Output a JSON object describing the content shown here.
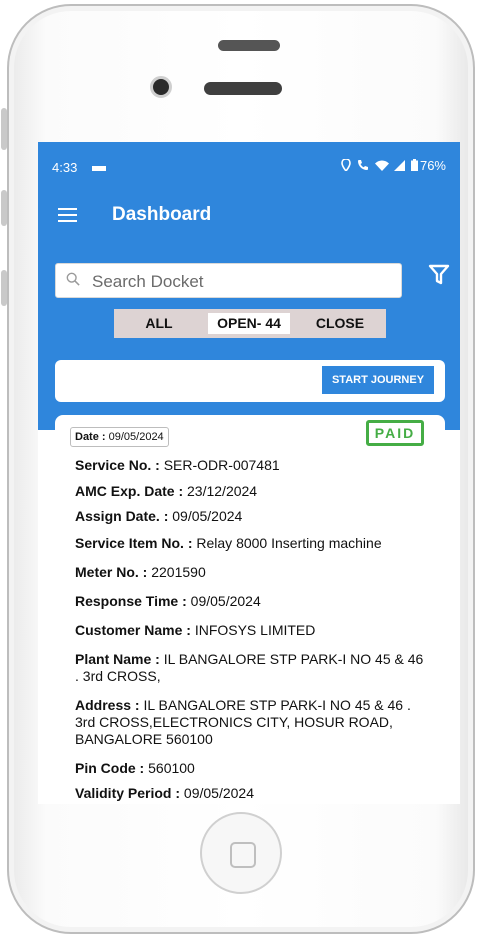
{
  "status_bar": {
    "time": "4:33",
    "battery": "76%"
  },
  "app_bar": {
    "title": "Dashboard"
  },
  "search": {
    "placeholder": "Search Docket"
  },
  "tabs": [
    {
      "label": "ALL",
      "active": false
    },
    {
      "label": "OPEN- 44",
      "active": true
    },
    {
      "label": "CLOSE",
      "active": false
    }
  ],
  "journey": {
    "button_label": "START JOURNEY"
  },
  "docket": {
    "date_label": "Date :",
    "date_value": "09/05/2024",
    "payment_status": "PAID",
    "fields": [
      {
        "label": "Service No. :",
        "value": "SER-ODR-007481"
      },
      {
        "label": "AMC Exp. Date :",
        "value": "23/12/2024"
      },
      {
        "label": "Assign Date. :",
        "value": "09/05/2024"
      },
      {
        "label": "Service Item No. :",
        "value": "Relay 8000 Inserting machine"
      },
      {
        "label": "Meter No. :",
        "value": "2201590"
      },
      {
        "label": "Response Time :",
        "value": "09/05/2024"
      },
      {
        "label": "Customer Name :",
        "value": "INFOSYS LIMITED"
      },
      {
        "label": "Plant Name :",
        "value": "IL BANGALORE STP PARK-I NO 45 & 46 . 3rd CROSS,"
      },
      {
        "label": "Address :",
        "value": "IL BANGALORE STP PARK-I NO 45 & 46 . 3rd CROSS,ELECTRONICS CITY, HOSUR ROAD, BANGALORE 560100"
      },
      {
        "label": "Pin Code :",
        "value": "560100"
      },
      {
        "label": "Validity Period :",
        "value": "09/05/2024"
      }
    ]
  },
  "colors": {
    "primary": "#2f86dc",
    "paid": "#45ad45",
    "tab_bg": "#ddd3d3"
  },
  "icons": [
    "menu-icon",
    "search-icon",
    "filter-icon",
    "location-icon",
    "phone-icon",
    "wifi-icon",
    "signal-icon",
    "battery-icon"
  ]
}
